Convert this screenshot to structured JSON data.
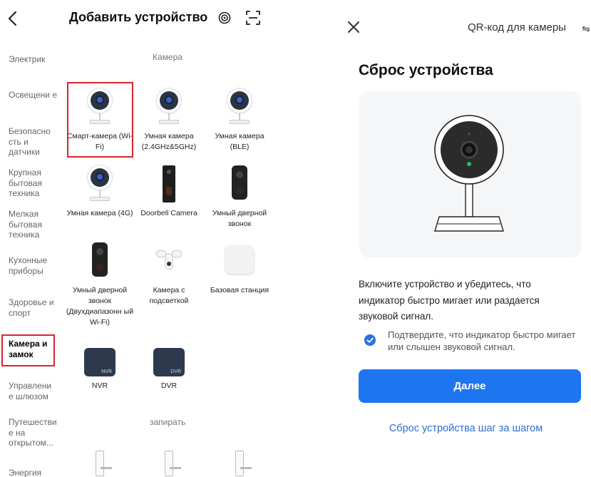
{
  "left": {
    "title": "Добавить устройство",
    "categories": [
      "Электрик",
      "Освещени е",
      "Безопасно сть и датчики",
      "Крупная бытовая техника",
      "Мелкая бытовая техника",
      "Кухонные приборы",
      "Здоровье и спорт",
      "Камера и замок",
      "Управлени е шлюзом",
      "Путешестви е на открытом...",
      "Энергия"
    ],
    "sections": {
      "camera": "Камера",
      "lock": "запирать"
    },
    "devices": [
      {
        "name": "Смарт-камера (Wi-Fi)",
        "icon": "indoor-camera-icon"
      },
      {
        "name": "Умная камера (2.4GHz&5GHz)",
        "icon": "indoor-camera-icon"
      },
      {
        "name": "Умная камера (BLE)",
        "icon": "indoor-camera-icon"
      },
      {
        "name": "Умная камера (4G)",
        "icon": "indoor-camera-icon"
      },
      {
        "name": "Doorbell Camera",
        "icon": "doorbell-icon"
      },
      {
        "name": "Умный дверной звонок",
        "icon": "doorbell-icon"
      },
      {
        "name": "Умный дверной звонок (Двухдиапазонн ый Wi-Fi)",
        "icon": "doorbell-icon"
      },
      {
        "name": "Камера с подсветкой",
        "icon": "floodlight-camera-icon"
      },
      {
        "name": "Базовая станция",
        "icon": "base-station-icon"
      },
      {
        "name": "NVR",
        "icon": "nvr-icon",
        "tag": "NVR"
      },
      {
        "name": "DVR",
        "icon": "dvr-icon",
        "tag": "DVR"
      }
    ]
  },
  "right": {
    "qr_link": "QR-код для камеры",
    "title": "Сброс устройства",
    "instructions": "Включите устройство и убедитесь, что индикатор быстро мигает или раздается звуковой сигнал.",
    "confirm": "Подтвердите, что индикатор быстро мигает или слышен звуковой сигнал.",
    "next_button": "Далее",
    "stepwise_link": "Сброс устройства шаг за шагом"
  },
  "colors": {
    "accent": "#1e75f0",
    "highlight": "#d9262c",
    "link": "#2f6fd6"
  }
}
